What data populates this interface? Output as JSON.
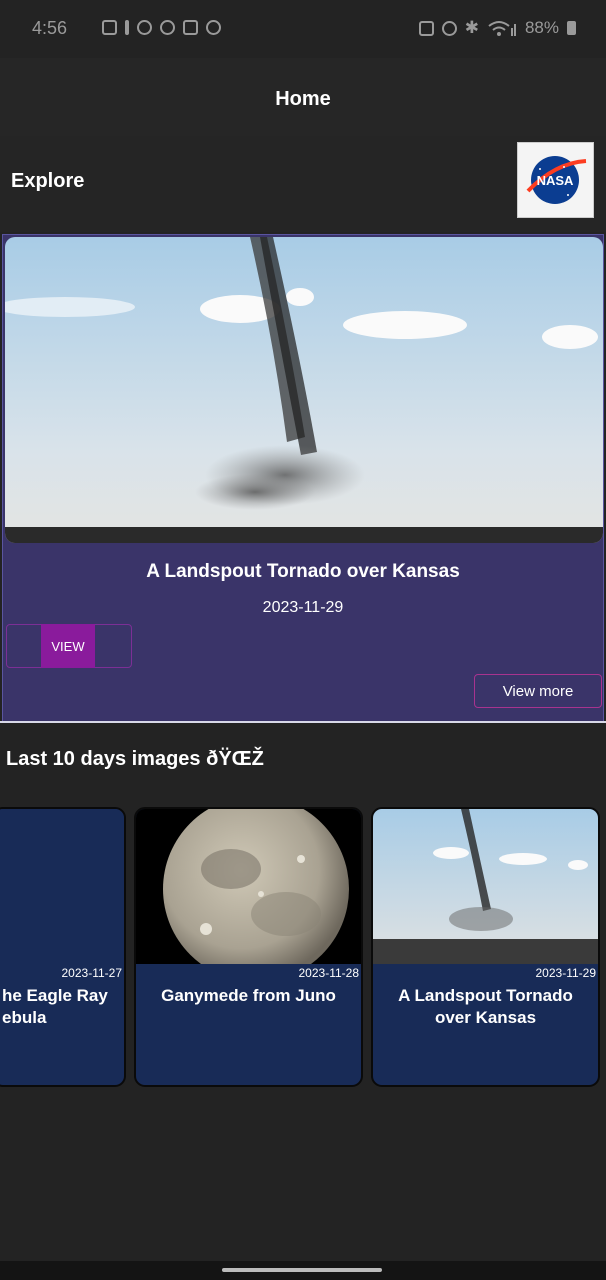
{
  "status_bar": {
    "time": "4:56",
    "battery": "88%",
    "left_icons": [
      "youtube-icon",
      "notification-icon",
      "app-icon",
      "pinwheel-icon",
      "gallery-icon",
      "instagram-icon"
    ],
    "right_icons": [
      "sim-icon",
      "alarm-icon",
      "bluetooth-icon",
      "wifi-icon",
      "signal-icon",
      "battery-icon"
    ]
  },
  "app_bar": {
    "title": "Home"
  },
  "explore": {
    "title": "Explore",
    "logo": "nasa-logo"
  },
  "featured": {
    "title": "A Landspout Tornado over Kansas",
    "date": "2023-11-29",
    "view_label": "VIEW",
    "view_more_label": "View more"
  },
  "recent": {
    "title": "Last 10 days images ðŸŒŽ",
    "items": [
      {
        "date": "2023-11-27",
        "title": "The Eagle Ray Nebula",
        "title_line1": "he Eagle Ray",
        "title_line2": "ebula"
      },
      {
        "date": "2023-11-28",
        "title": "Ganymede from Juno",
        "title_line1": "Ganymede from Juno",
        "title_line2": ""
      },
      {
        "date": "2023-11-29",
        "title": "A Landspout Tornado over Kansas",
        "title_line1": "A Landspout Tornado",
        "title_line2": "over Kansas"
      }
    ]
  },
  "colors": {
    "background": "#232323",
    "featured_card": "#3a3469",
    "view_button": "#8a1b9c",
    "thumb_card": "#182b57"
  }
}
